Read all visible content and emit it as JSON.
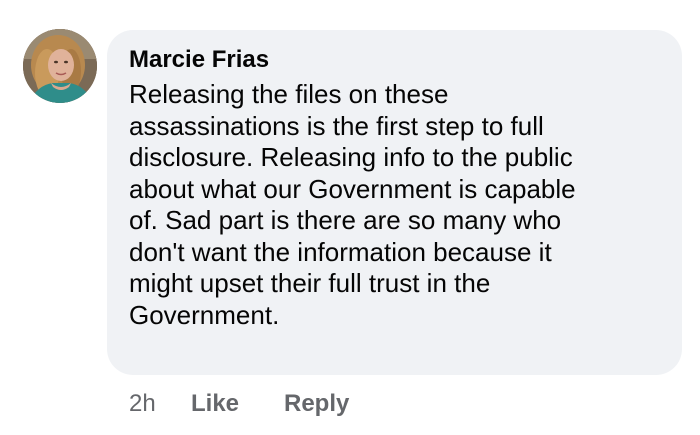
{
  "comment": {
    "author": "Marcie Frias",
    "avatar_icon": "user-profile-photo",
    "text_lines": [
      "Releasing the files on these",
      "assassinations is the first step to full",
      "disclosure. Releasing info to the public",
      "about what our Government is capable",
      "of. Sad part is there are so many who",
      "don't want the information because it",
      "might upset their full trust in the",
      "Government."
    ],
    "timestamp": "2h",
    "like_label": "Like",
    "reply_label": "Reply"
  },
  "colors": {
    "bubble": "#f0f2f5",
    "text": "#050505",
    "secondary": "#65676b"
  }
}
